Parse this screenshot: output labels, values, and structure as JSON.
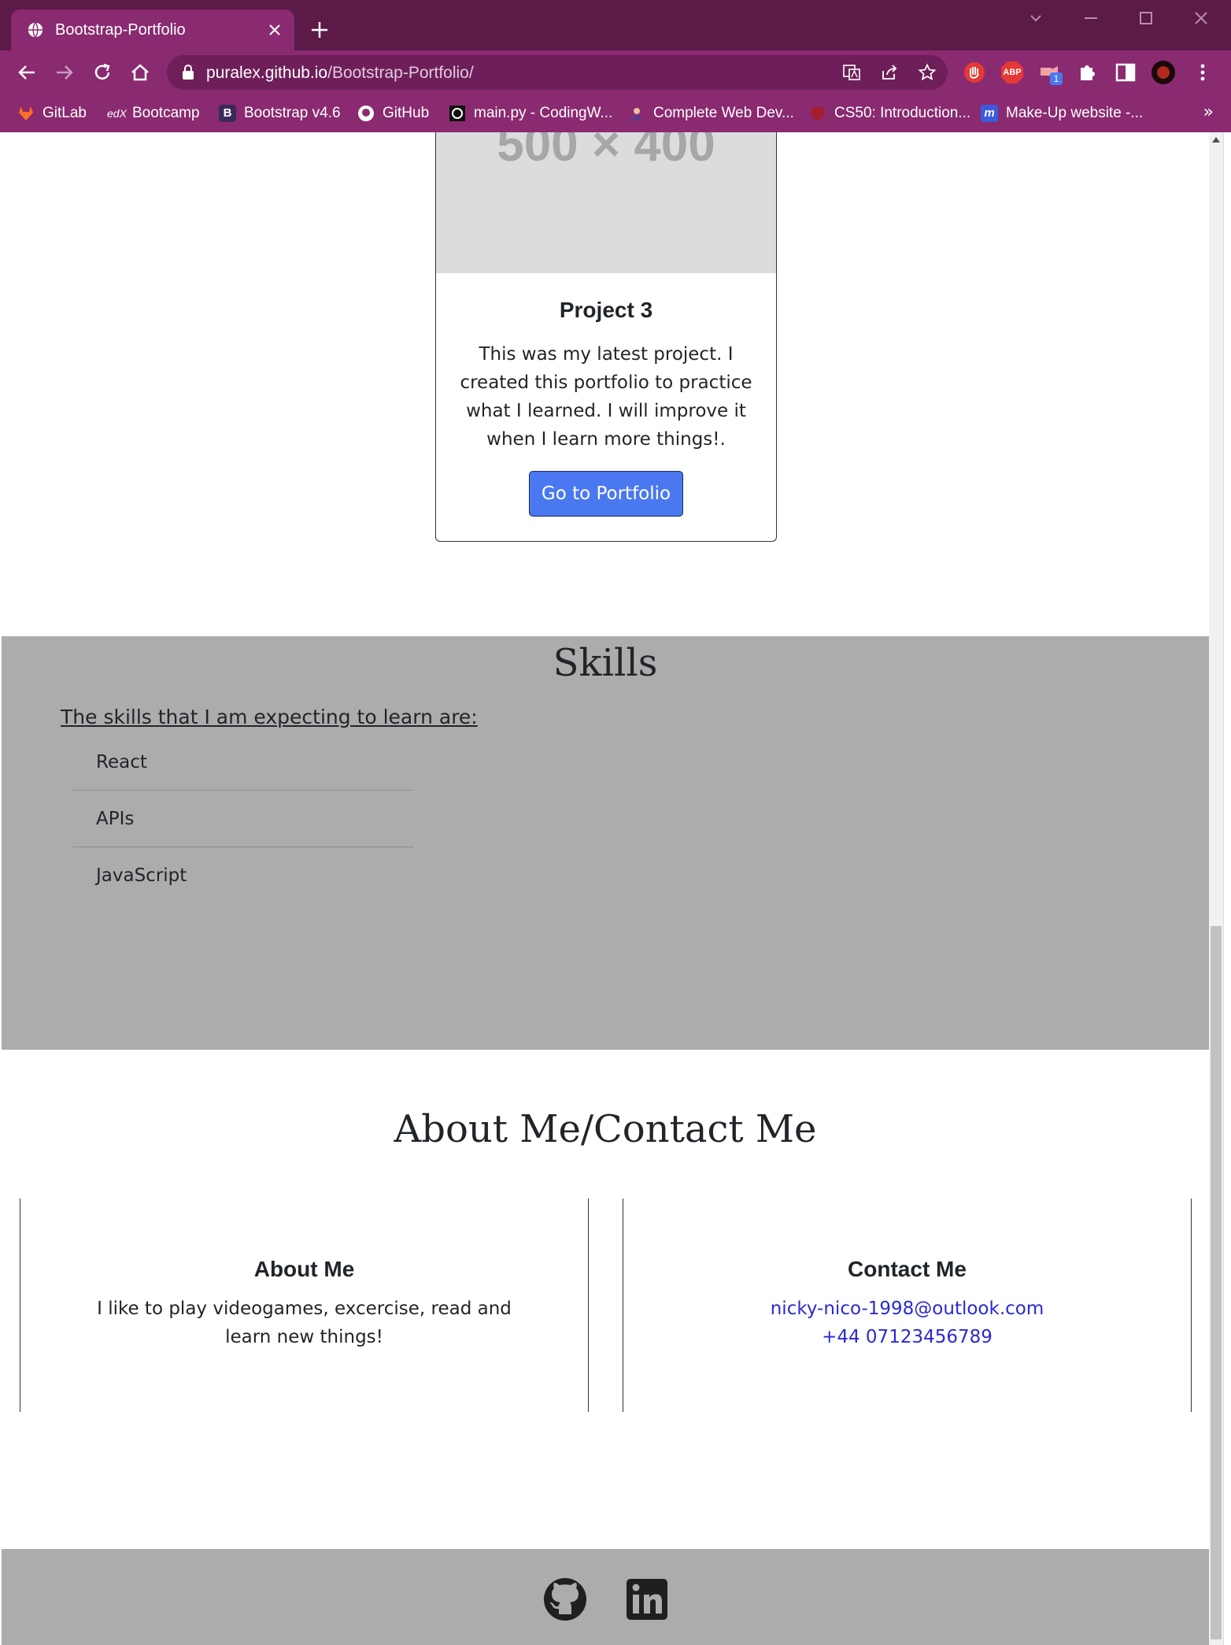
{
  "browser": {
    "tab_title": "Bootstrap-Portfolio",
    "url_host": "puralex.github.io",
    "url_path": "/Bootstrap-Portfolio/",
    "bookmarks": [
      {
        "label": "GitLab",
        "icon": "gitlab-icon"
      },
      {
        "label": "Bootcamp",
        "icon": "edx-icon"
      },
      {
        "label": "Bootstrap v4.6",
        "icon": "bootstrap-icon"
      },
      {
        "label": "GitHub",
        "icon": "github-icon"
      },
      {
        "label": "main.py - CodingW...",
        "icon": "codingw-icon"
      },
      {
        "label": "Complete Web Dev...",
        "icon": "udemy-icon"
      },
      {
        "label": "CS50: Introduction...",
        "icon": "harvard-icon"
      },
      {
        "label": "Make-Up website -...",
        "icon": "m-icon"
      }
    ],
    "extension_badge": "1",
    "abp_label": "ABP"
  },
  "project": {
    "image_placeholder": "500 × 400",
    "title": "Project 3",
    "text": "This was my latest project. I created this portfolio to practice what I learned. I will improve it when I learn more things!.",
    "button": "Go to Portfolio"
  },
  "skills": {
    "title": "Skills",
    "intro": "The skills that I am expecting to learn are:",
    "items": [
      "React",
      "APIs",
      "JavaScript"
    ]
  },
  "about": {
    "title": "About Me/Contact Me",
    "about_heading": "About Me",
    "about_text": "I like to play videogames, excercise, read and learn new things!",
    "contact_heading": "Contact Me",
    "email": "nicky-nico-1998@outlook.com",
    "phone": "+44 07123456789"
  },
  "footer": {
    "icons": [
      "github-icon",
      "linkedin-icon"
    ]
  },
  "colors": {
    "chrome_dark": "#5c1a48",
    "chrome_light": "#8a2a70",
    "section_gray": "#adacad",
    "button_blue": "#4a78f0",
    "link_blue": "#2a2ad0"
  }
}
